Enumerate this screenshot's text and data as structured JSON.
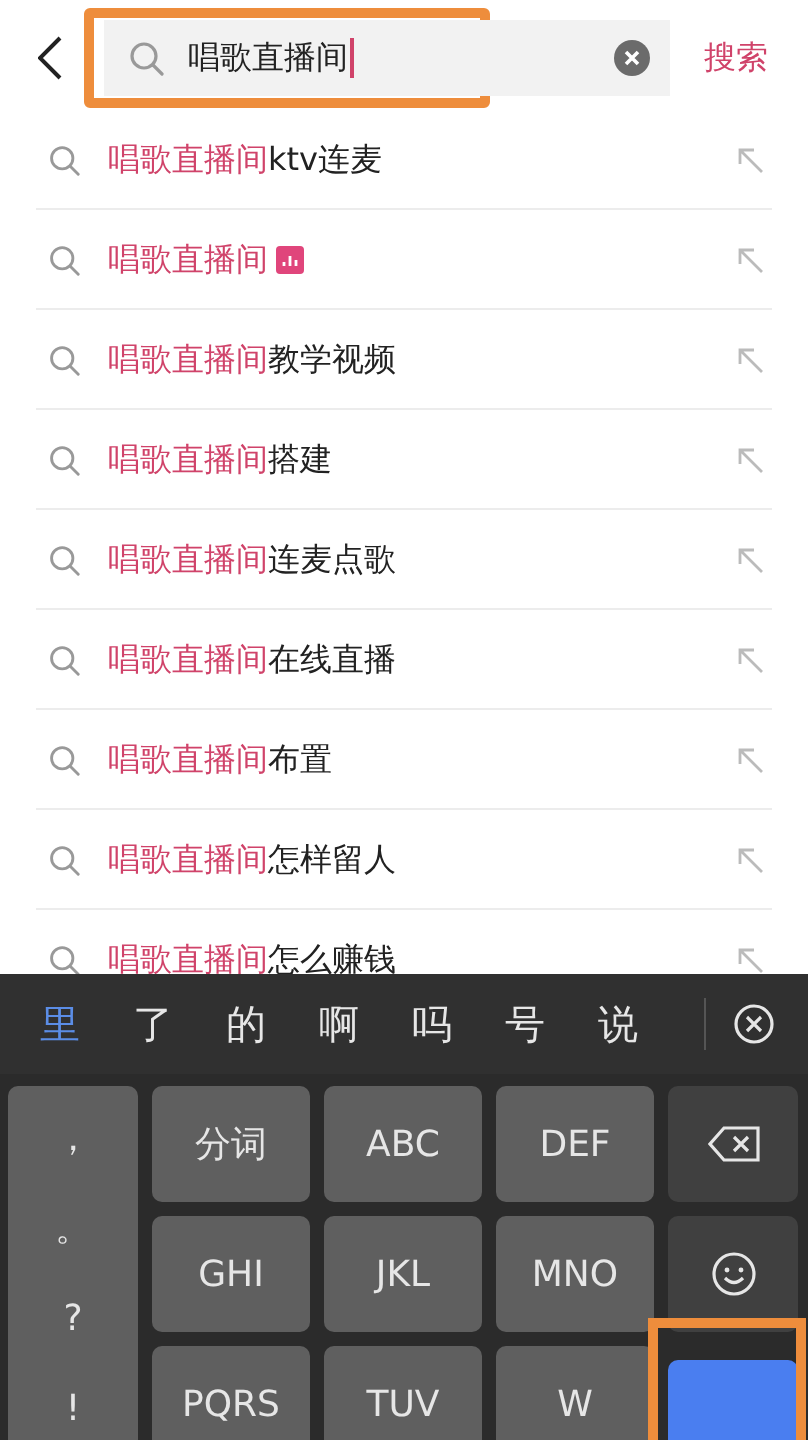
{
  "header": {
    "search": {
      "value": "唱歌直播间",
      "annotated": true
    },
    "search_button": "搜索"
  },
  "suggestions": [
    {
      "highlight": "唱歌直播间",
      "rest": "ktv连麦",
      "badge": false
    },
    {
      "highlight": "唱歌直播间",
      "badge": true
    },
    {
      "highlight": "唱歌直播间",
      "rest": "教学视频",
      "badge": false
    },
    {
      "highlight": "唱歌直播间",
      "rest": "搭建",
      "badge": false
    },
    {
      "highlight": "唱歌直播间",
      "rest": "连麦点歌",
      "badge": false
    },
    {
      "highlight": "唱歌直播间",
      "rest": "在线直播",
      "badge": false
    },
    {
      "highlight": "唱歌直播间",
      "rest": "布置",
      "badge": false
    },
    {
      "highlight": "唱歌直播间",
      "rest": "怎样留人",
      "badge": false
    },
    {
      "highlight": "唱歌直播间",
      "rest": "怎么赚钱",
      "badge": false
    }
  ],
  "keyboard": {
    "candidates": [
      {
        "text": "里",
        "selected": true
      },
      {
        "text": "了",
        "selected": false
      },
      {
        "text": "的",
        "selected": false
      },
      {
        "text": "啊",
        "selected": false
      },
      {
        "text": "吗",
        "selected": false
      },
      {
        "text": "号",
        "selected": false
      },
      {
        "text": "说",
        "selected": false
      }
    ],
    "symbols": [
      "，",
      "。",
      "?",
      "!"
    ],
    "keys": [
      {
        "kind": "text",
        "label": "分词"
      },
      {
        "kind": "text",
        "label": "ABC"
      },
      {
        "kind": "text",
        "label": "DEF"
      },
      {
        "kind": "delete"
      },
      {
        "kind": "text",
        "label": "GHI"
      },
      {
        "kind": "text",
        "label": "JKL"
      },
      {
        "kind": "text",
        "label": "MNO"
      },
      {
        "kind": "emoji"
      },
      {
        "kind": "text",
        "label": "PQRS"
      },
      {
        "kind": "text",
        "label": "TUV"
      },
      {
        "kind": "text",
        "label": "W"
      },
      {
        "kind": "enter",
        "annotated": true
      }
    ]
  }
}
